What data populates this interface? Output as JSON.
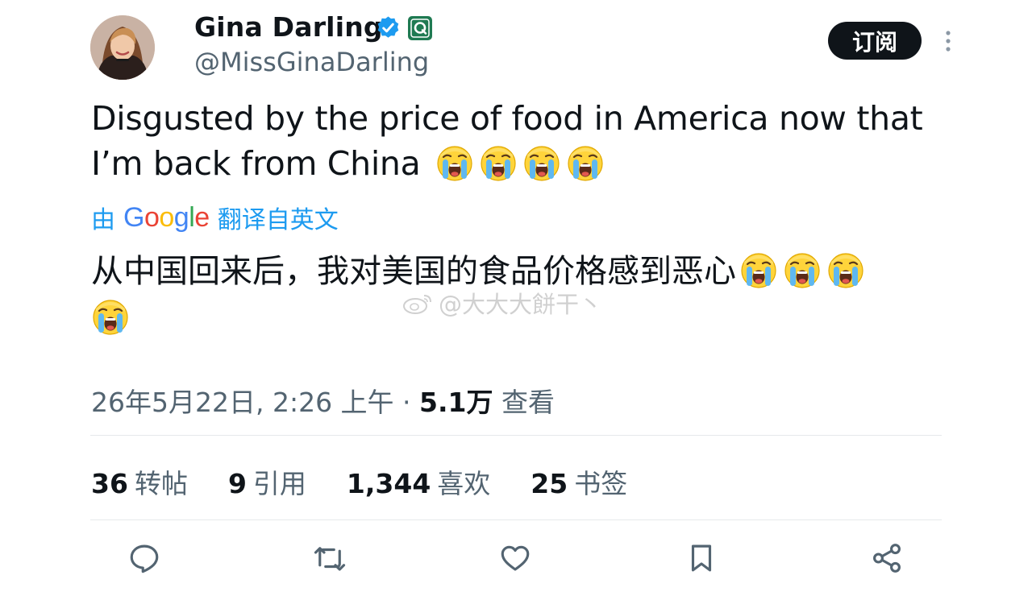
{
  "author": {
    "display_name": "Gina Darling",
    "handle": "@MissGinaDarling",
    "subscribe_label": "订阅"
  },
  "tweet": {
    "text_line1": "Disgusted by the price of food in America now that",
    "text_line2": "I’m back from China",
    "translate_prefix": "由",
    "translate_brand": "Google",
    "translate_suffix": "翻译自英文",
    "translated_text": "从中国回来后，我对美国的食品价格感到恶心",
    "emoji": "loudly-crying-face"
  },
  "watermark": {
    "text": "@大大大餅干丶"
  },
  "meta": {
    "timestamp": "26年5月22日, 2:26 上午",
    "separator": " · ",
    "views_count": "5.1万",
    "views_label": "查看"
  },
  "stats": {
    "reposts_count": "36",
    "reposts_label": "转帖",
    "quotes_count": "9",
    "quotes_label": "引用",
    "likes_count": "1,344",
    "likes_label": "喜欢",
    "bookmarks_count": "25",
    "bookmarks_label": "书签"
  },
  "actions": [
    "reply-icon",
    "repost-icon",
    "like-icon",
    "bookmark-icon",
    "share-icon"
  ],
  "colors": {
    "accent_blue": "#1d9bf0",
    "secondary_text": "#536471",
    "primary_text": "#0f1419",
    "button_bg": "#0f1419"
  }
}
